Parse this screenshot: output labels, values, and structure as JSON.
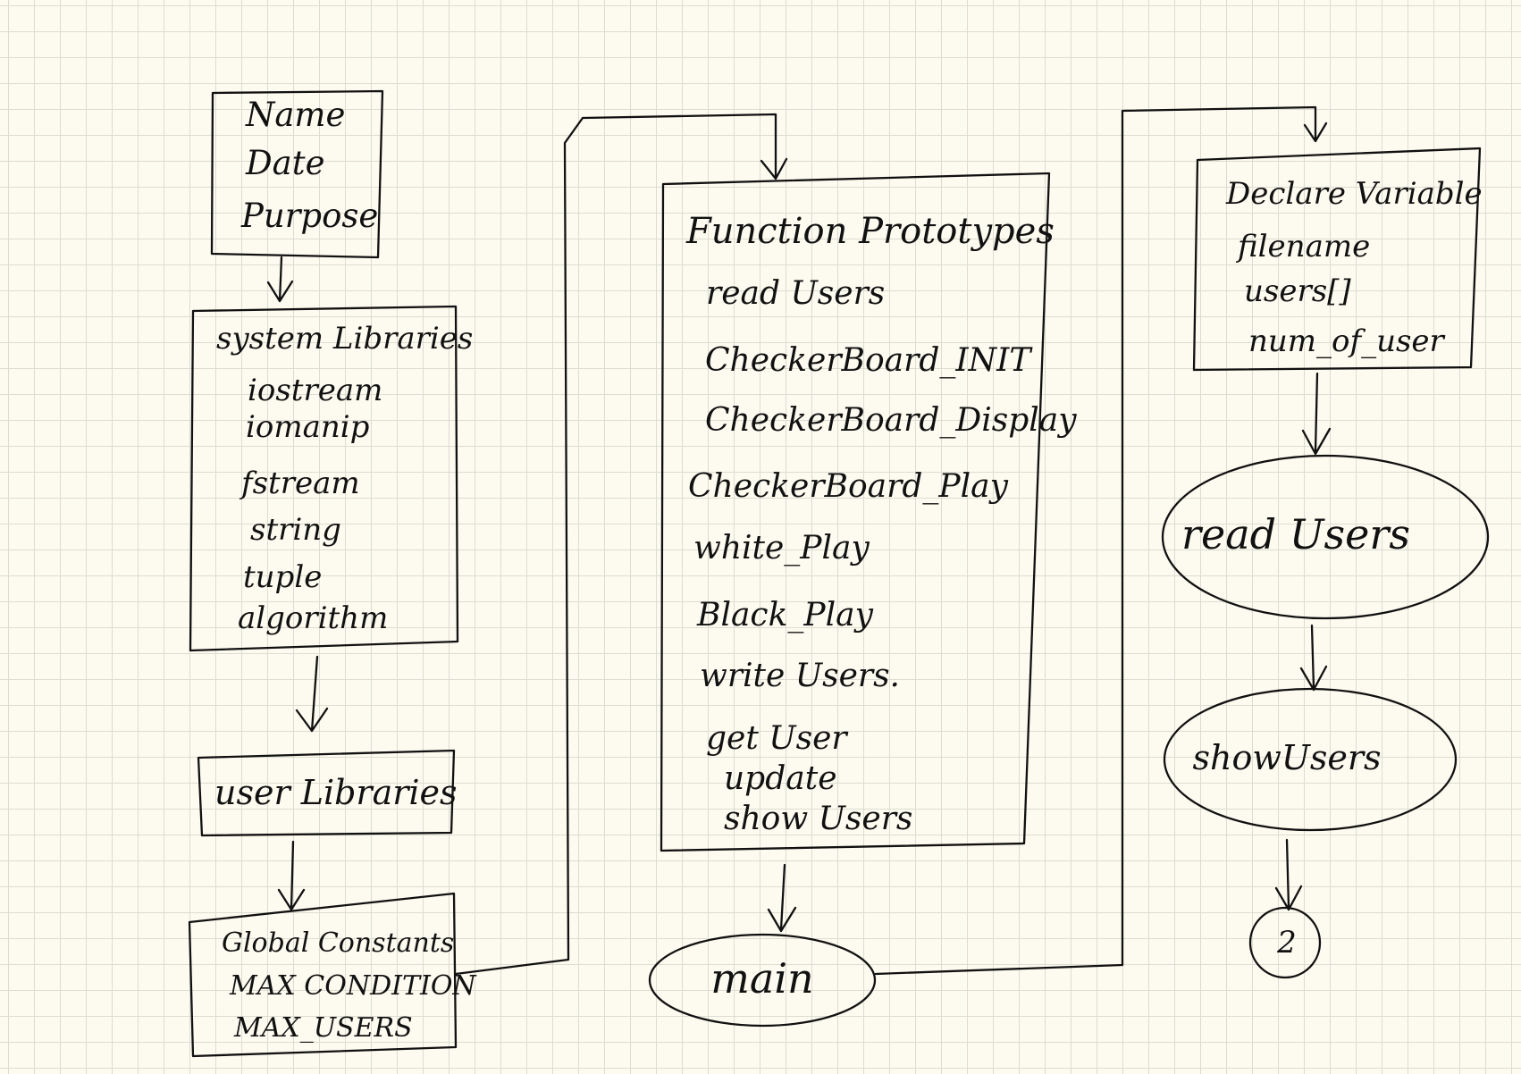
{
  "header_box": {
    "lines": [
      "Name",
      "Date",
      "Purpose"
    ]
  },
  "system_libraries": {
    "title": "system Libraries",
    "items": [
      "iostream",
      "iomanip",
      "fstream",
      "string",
      "tuple",
      "algorithm"
    ]
  },
  "user_libraries": {
    "title": "user Libraries"
  },
  "global_constants": {
    "title": "Global Constants",
    "items": [
      "MAX CONDITION",
      "MAX_USERS"
    ]
  },
  "function_prototypes": {
    "title": "Function Prototypes",
    "items": [
      "read Users",
      "CheckerBoard_INIT",
      "CheckerBoard_Display",
      "CheckerBoard_Play",
      "white_Play",
      "Black_Play",
      "write Users.",
      "get User",
      "update",
      "show Users"
    ]
  },
  "main_node": {
    "label": "main"
  },
  "declare_variable": {
    "title": "Declare Variable",
    "items": [
      "filename",
      "users[]",
      "num_of_user"
    ]
  },
  "read_users_node": {
    "label": "read Users"
  },
  "show_users_node": {
    "label": "showUsers"
  },
  "connector": {
    "label": "2"
  }
}
